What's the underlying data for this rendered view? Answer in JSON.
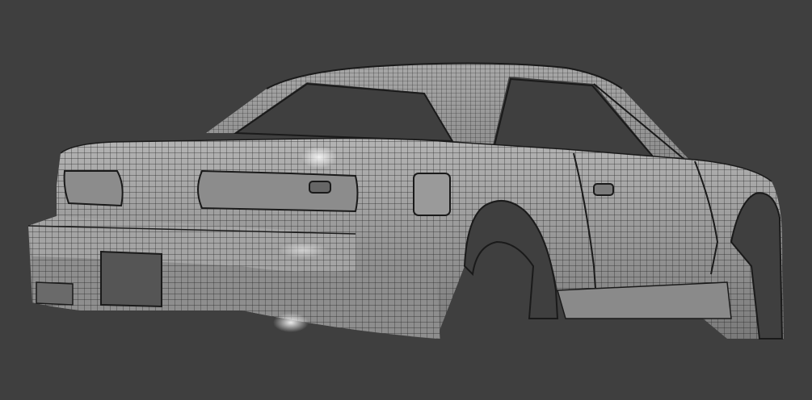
{
  "viewport": {
    "background_color": "#3f3f3f",
    "model": {
      "subject": "car-body-wireframe",
      "shading": "clay-with-wireframe",
      "surface_color": "#9a9a9a",
      "wire_color": "#262626",
      "highlight_color": "#e8e8e8"
    }
  }
}
